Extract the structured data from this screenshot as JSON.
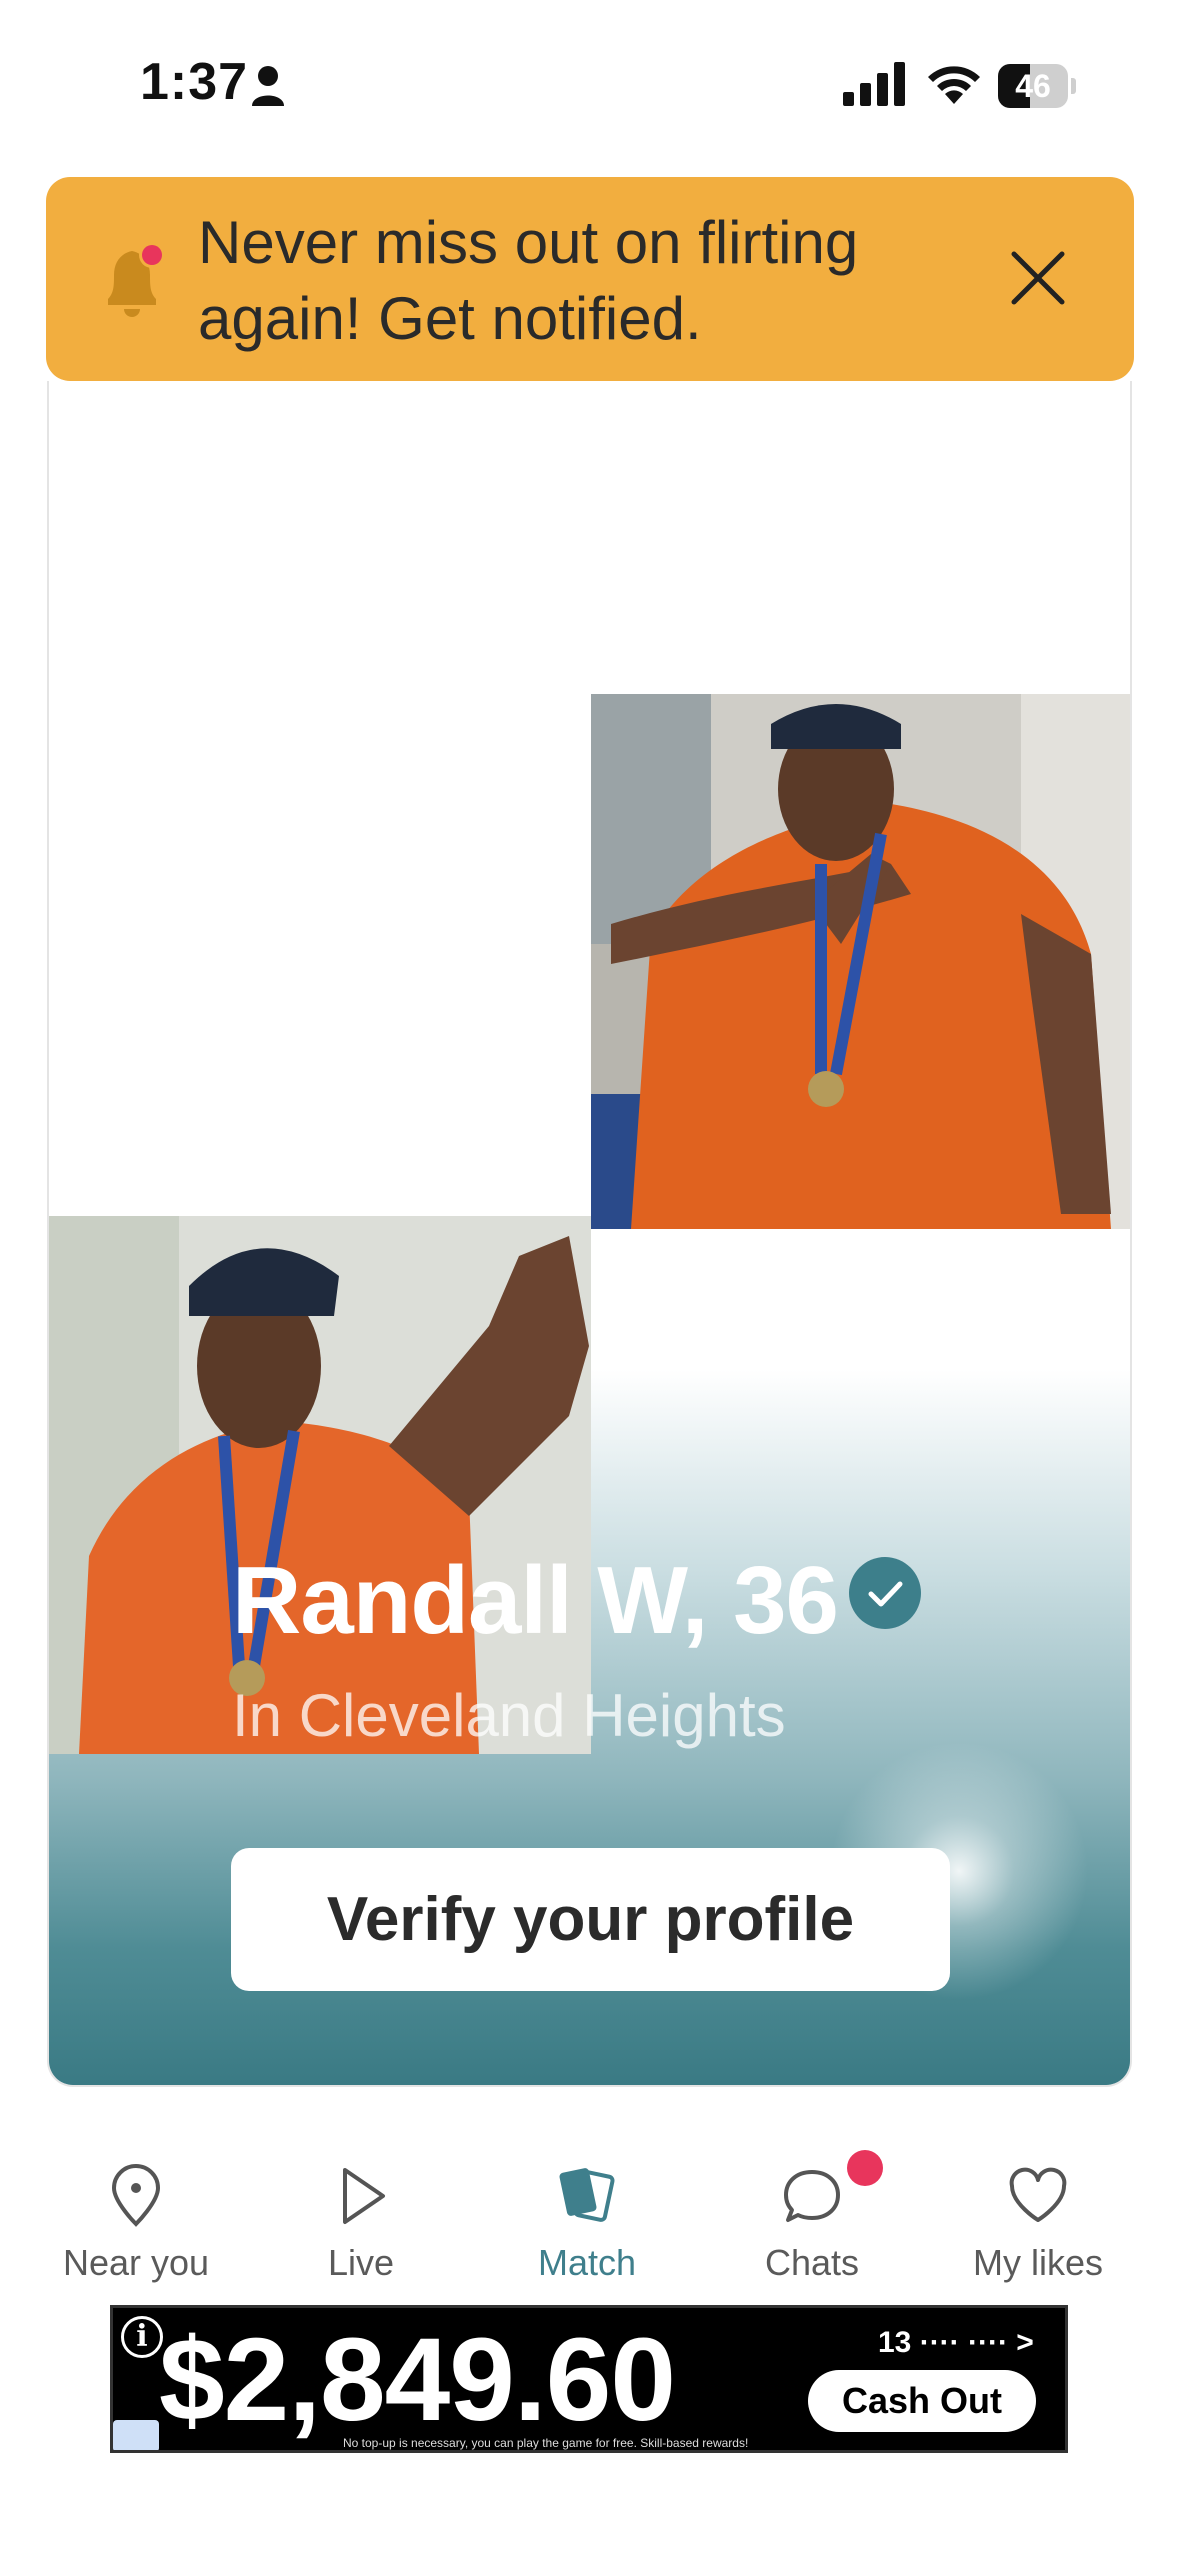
{
  "status_bar": {
    "time": "1:37",
    "battery": "46",
    "battery_level": 0.46
  },
  "banner": {
    "text": "Never miss out on flirting again! Get notified.",
    "color": "#F2AE3F"
  },
  "profile": {
    "name": "Randall W, 36",
    "location": "In Cleveland Heights",
    "verified": true,
    "verify_button_label": "Verify your profile"
  },
  "nav": {
    "items": [
      {
        "label": "Near you",
        "icon": "location-pin-icon",
        "active": false
      },
      {
        "label": "Live",
        "icon": "play-icon",
        "active": false
      },
      {
        "label": "Match",
        "icon": "cards-icon",
        "active": true
      },
      {
        "label": "Chats",
        "icon": "chat-bubble-icon",
        "active": false,
        "badge": true
      },
      {
        "label": "My likes",
        "icon": "heart-icon",
        "active": false
      }
    ],
    "active_color": "#3f7f8c",
    "badge_color": "#E8355C"
  },
  "ad": {
    "amount": "$2,849.60",
    "code": "13 ···· ···· >",
    "cta": "Cash Out",
    "disclaimer": "No top-up is necessary, you can play the game for free. Skill-based rewards!",
    "info": "i"
  }
}
